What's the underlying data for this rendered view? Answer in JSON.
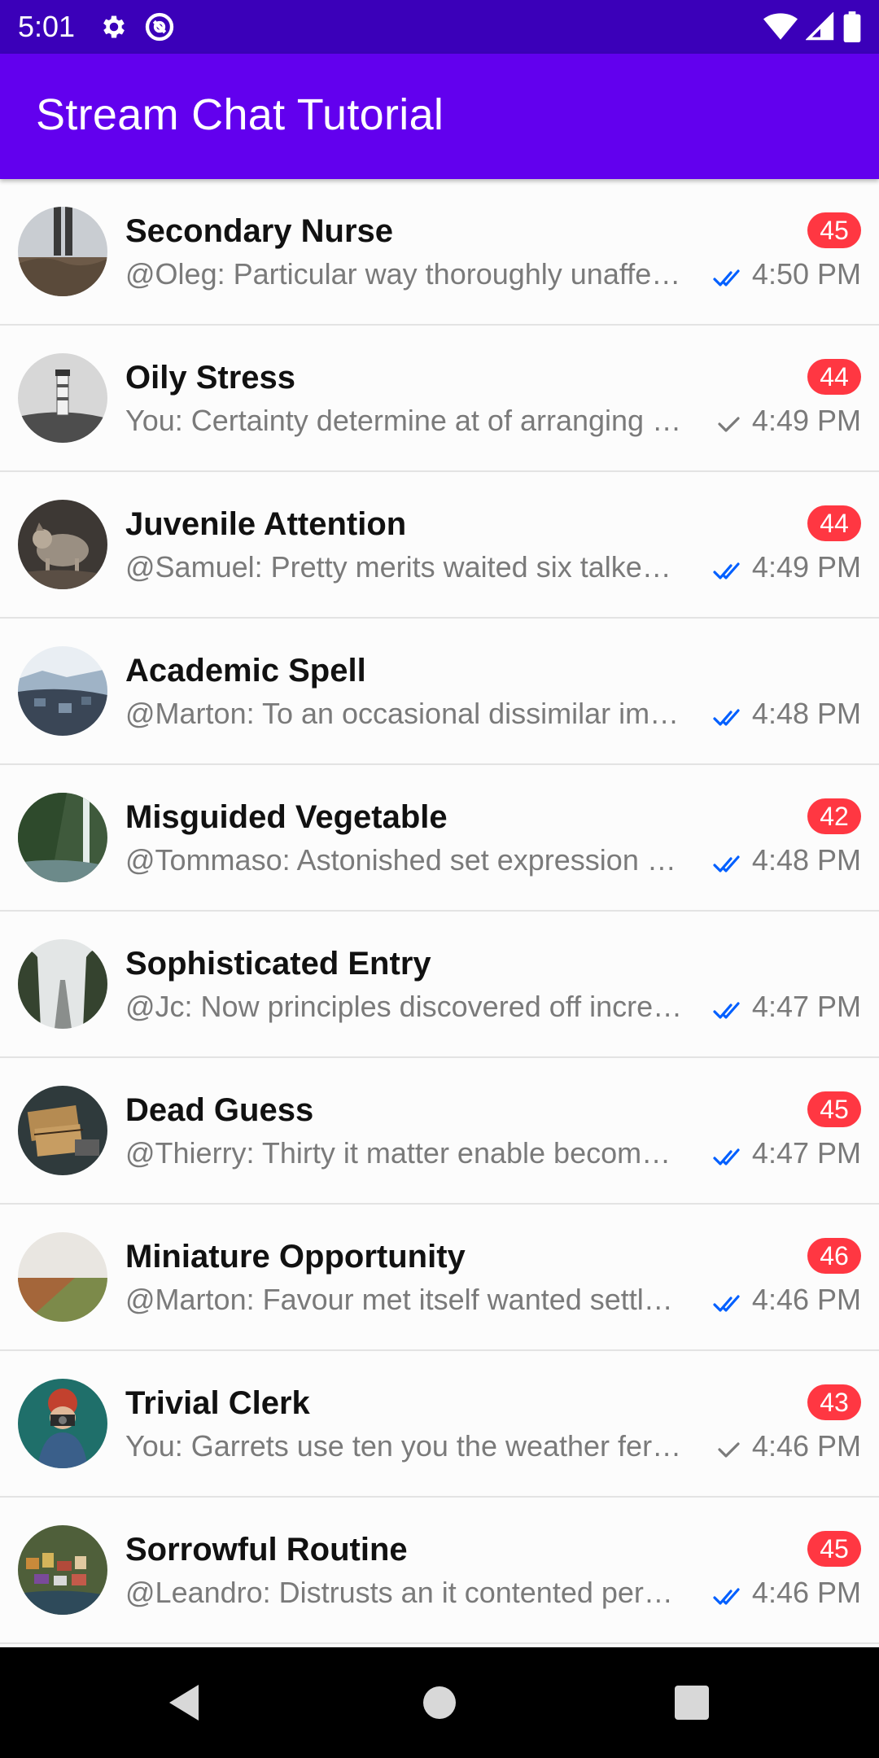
{
  "status_bar": {
    "time": "5:01",
    "left_icons": [
      "gear-icon",
      "sync-icon"
    ],
    "right_icons": [
      "wifi-icon",
      "signal-icon",
      "battery-icon"
    ]
  },
  "app_bar": {
    "title": "Stream Chat Tutorial",
    "color": "#6200ee"
  },
  "colors": {
    "status_bar": "#3b00b9",
    "badge": "#ff3742",
    "read_check": "#005fff",
    "sent_check": "#7a7a7a"
  },
  "channels": [
    {
      "name": "Secondary Nurse",
      "preview": "@Oleg: Particular way thoroughly unaffected projection",
      "unread": "45",
      "status": "read",
      "time": "4:50 PM",
      "avatar": "feet-on-rocks"
    },
    {
      "name": "Oily Stress",
      "preview": "You: Certainty determine at of arranging perceived situation",
      "unread": "44",
      "status": "sent",
      "time": "4:49 PM",
      "avatar": "lighthouse"
    },
    {
      "name": "Juvenile Attention",
      "preview": "@Samuel: Pretty merits waited six talked pulled you",
      "unread": "44",
      "status": "read",
      "time": "4:49 PM",
      "avatar": "wolf"
    },
    {
      "name": "Academic Spell",
      "preview": "@Marton: To an occasional dissimilar impossible sentiments",
      "unread": "",
      "status": "read",
      "time": "4:48 PM",
      "avatar": "snowy-village"
    },
    {
      "name": "Misguided Vegetable",
      "preview": "@Tommaso: Astonished set expression solicitude way",
      "unread": "42",
      "status": "read",
      "time": "4:48 PM",
      "avatar": "waterfall"
    },
    {
      "name": "Sophisticated Entry",
      "preview": "@Jc: Now principles discovered off increasing affection",
      "unread": "",
      "status": "read",
      "time": "4:47 PM",
      "avatar": "foggy-road"
    },
    {
      "name": "Dead Guess",
      "preview": "@Thierry: Thirty it matter enable become admire in",
      "unread": "45",
      "status": "read",
      "time": "4:47 PM",
      "avatar": "parcels"
    },
    {
      "name": "Miniature Opportunity",
      "preview": "@Marton: Favour met itself wanted settle put garret",
      "unread": "46",
      "status": "read",
      "time": "4:46 PM",
      "avatar": "field"
    },
    {
      "name": "Trivial Clerk",
      "preview": "You: Garrets use ten you the weather ferrars venture",
      "unread": "43",
      "status": "sent",
      "time": "4:46 PM",
      "avatar": "photographer"
    },
    {
      "name": "Sorrowful Routine",
      "preview": "@Leandro: Distrusts an it contented perceived attending",
      "unread": "45",
      "status": "read",
      "time": "4:46 PM",
      "avatar": "coastal-town"
    }
  ],
  "nav_bar": {
    "buttons": [
      "back-icon",
      "home-icon",
      "recents-icon"
    ]
  }
}
